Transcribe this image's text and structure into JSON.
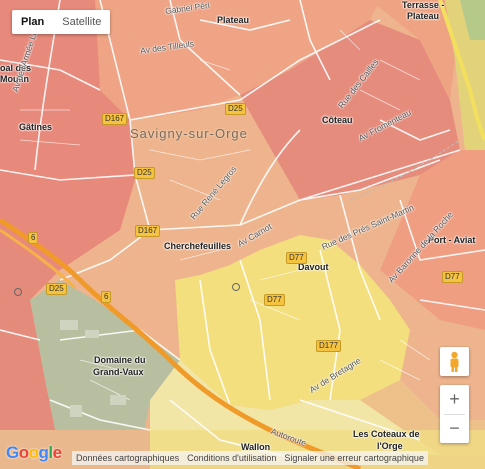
{
  "map_type": {
    "plan": "Plan",
    "satellite": "Satellite",
    "selected": "Plan"
  },
  "city": "Savigny-sur-Orge",
  "places": {
    "gatines": "Gâtines",
    "coteau": "Côteau",
    "plateau": "Plateau",
    "cherchefeuilles": "Cherchefeuilles",
    "davout": "Davout",
    "port_aviat": "Port - Aviat",
    "domaine_l1": "Domaine du",
    "domaine_l2": "Grand-Vaux",
    "wallon": "Wallon",
    "coteaux_l1": "Les Coteaux de",
    "coteaux_l2": "l'Orge",
    "terrasse_l1": "Terrasse -",
    "terrasse_l2": "Plateau",
    "moulin_l1": "oal des",
    "moulin_l2": "Moulin"
  },
  "streets": {
    "tilleuls": "Av des Tilleuls",
    "armee_leclerc": "Av de l'Armée Leclerc",
    "gabriel_peri": "Gabriel Péri",
    "cailles": "Rue des Cailles",
    "fromenteau": "Av Fromenteau",
    "rene_legros": "Rue René Legros",
    "carnot": "Av Carnot",
    "pres_saint_martin": "Rue des Prés Saint-Martin",
    "baronne_roche": "Av Baronne de la Roche",
    "bretagne": "Av de Bretagne",
    "autoroute": "Autoroute"
  },
  "road_shields": {
    "d167_top": "D167",
    "d25_top": "D25",
    "d25_mid": "D25",
    "d167_mid": "D167",
    "d77_a": "D77",
    "d77_b": "D77",
    "d77_right": "D77",
    "d177": "D177",
    "d25_left": "D25",
    "r6_a": "6",
    "r6_b": "6"
  },
  "footer": {
    "map_data": "Données cartographiques",
    "terms": "Conditions d'utilisation",
    "report": "Signaler une erreur cartographique"
  },
  "logo": "Google",
  "colors": {
    "zone_red": "#e58a7b",
    "zone_salmon": "#efa283",
    "zone_orange": "#f1b888",
    "zone_yellow": "#f3df7e",
    "zone_paleyellow": "#f4ecae",
    "zone_green": "#b9c59a",
    "highway": "#f09a2a",
    "shield": "#f5c340"
  }
}
